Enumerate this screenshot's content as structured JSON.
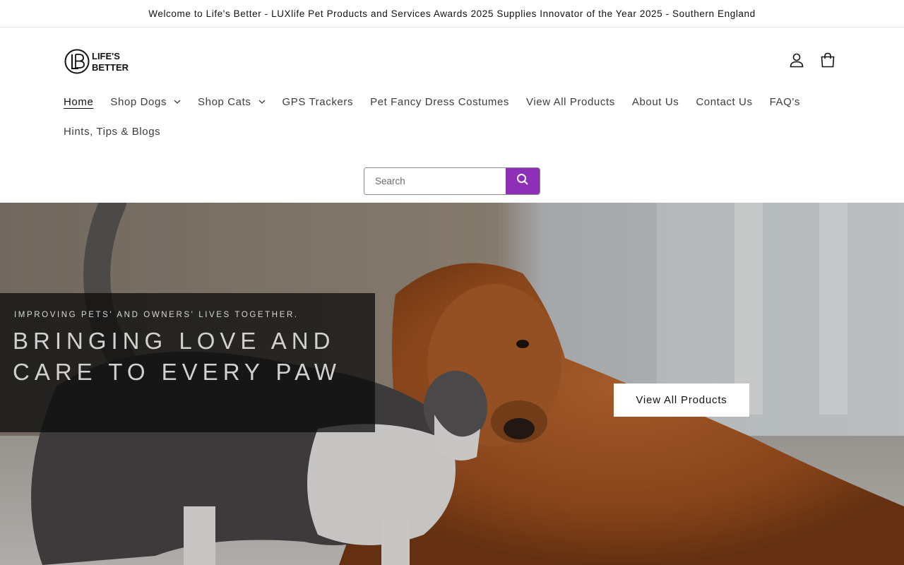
{
  "announcement": {
    "text": "Welcome to Life's Better - LUXlife Pet Products and Services Awards 2025 Supplies Innovator of the Year 2025 - Southern England"
  },
  "header": {
    "logo": {
      "line1": "LIFE'S",
      "line2": "BETTER",
      "mark": "LB"
    },
    "icons": {
      "account": "account-icon",
      "cart": "cart-icon"
    }
  },
  "nav": {
    "items": [
      {
        "label": "Home",
        "active": true,
        "dropdown": false
      },
      {
        "label": "Shop Dogs",
        "active": false,
        "dropdown": true
      },
      {
        "label": "Shop Cats",
        "active": false,
        "dropdown": true
      },
      {
        "label": "GPS Trackers",
        "active": false,
        "dropdown": false
      },
      {
        "label": "Pet Fancy Dress Costumes",
        "active": false,
        "dropdown": false
      },
      {
        "label": "View All Products",
        "active": false,
        "dropdown": false
      },
      {
        "label": "About Us",
        "active": false,
        "dropdown": false
      },
      {
        "label": "Contact Us",
        "active": false,
        "dropdown": false
      },
      {
        "label": "FAQ's",
        "active": false,
        "dropdown": false
      },
      {
        "label": "Hints, Tips & Blogs",
        "active": false,
        "dropdown": false
      }
    ]
  },
  "search": {
    "placeholder": "Search",
    "value": "",
    "button_color": "#8e2fb8",
    "icon": "search-icon"
  },
  "hero": {
    "kicker": "IMPROVING PETS' AND OWNERS' LIVES TOGETHER.",
    "headline_line1": "BRINGING LOVE AND",
    "headline_line2": "CARE TO EVERY PAW",
    "cta_label": "View All Products"
  }
}
